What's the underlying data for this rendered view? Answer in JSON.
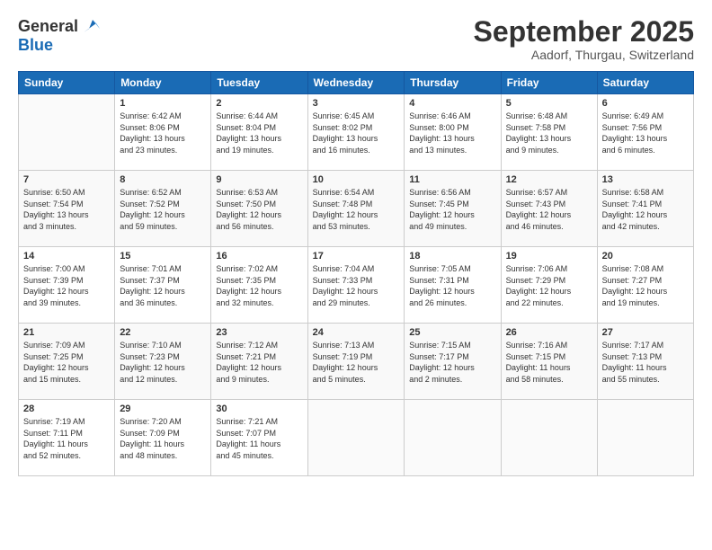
{
  "logo": {
    "general": "General",
    "blue": "Blue"
  },
  "title": "September 2025",
  "subtitle": "Aadorf, Thurgau, Switzerland",
  "weekdays": [
    "Sunday",
    "Monday",
    "Tuesday",
    "Wednesday",
    "Thursday",
    "Friday",
    "Saturday"
  ],
  "weeks": [
    [
      {
        "day": "",
        "info": ""
      },
      {
        "day": "1",
        "info": "Sunrise: 6:42 AM\nSunset: 8:06 PM\nDaylight: 13 hours\nand 23 minutes."
      },
      {
        "day": "2",
        "info": "Sunrise: 6:44 AM\nSunset: 8:04 PM\nDaylight: 13 hours\nand 19 minutes."
      },
      {
        "day": "3",
        "info": "Sunrise: 6:45 AM\nSunset: 8:02 PM\nDaylight: 13 hours\nand 16 minutes."
      },
      {
        "day": "4",
        "info": "Sunrise: 6:46 AM\nSunset: 8:00 PM\nDaylight: 13 hours\nand 13 minutes."
      },
      {
        "day": "5",
        "info": "Sunrise: 6:48 AM\nSunset: 7:58 PM\nDaylight: 13 hours\nand 9 minutes."
      },
      {
        "day": "6",
        "info": "Sunrise: 6:49 AM\nSunset: 7:56 PM\nDaylight: 13 hours\nand 6 minutes."
      }
    ],
    [
      {
        "day": "7",
        "info": "Sunrise: 6:50 AM\nSunset: 7:54 PM\nDaylight: 13 hours\nand 3 minutes."
      },
      {
        "day": "8",
        "info": "Sunrise: 6:52 AM\nSunset: 7:52 PM\nDaylight: 12 hours\nand 59 minutes."
      },
      {
        "day": "9",
        "info": "Sunrise: 6:53 AM\nSunset: 7:50 PM\nDaylight: 12 hours\nand 56 minutes."
      },
      {
        "day": "10",
        "info": "Sunrise: 6:54 AM\nSunset: 7:48 PM\nDaylight: 12 hours\nand 53 minutes."
      },
      {
        "day": "11",
        "info": "Sunrise: 6:56 AM\nSunset: 7:45 PM\nDaylight: 12 hours\nand 49 minutes."
      },
      {
        "day": "12",
        "info": "Sunrise: 6:57 AM\nSunset: 7:43 PM\nDaylight: 12 hours\nand 46 minutes."
      },
      {
        "day": "13",
        "info": "Sunrise: 6:58 AM\nSunset: 7:41 PM\nDaylight: 12 hours\nand 42 minutes."
      }
    ],
    [
      {
        "day": "14",
        "info": "Sunrise: 7:00 AM\nSunset: 7:39 PM\nDaylight: 12 hours\nand 39 minutes."
      },
      {
        "day": "15",
        "info": "Sunrise: 7:01 AM\nSunset: 7:37 PM\nDaylight: 12 hours\nand 36 minutes."
      },
      {
        "day": "16",
        "info": "Sunrise: 7:02 AM\nSunset: 7:35 PM\nDaylight: 12 hours\nand 32 minutes."
      },
      {
        "day": "17",
        "info": "Sunrise: 7:04 AM\nSunset: 7:33 PM\nDaylight: 12 hours\nand 29 minutes."
      },
      {
        "day": "18",
        "info": "Sunrise: 7:05 AM\nSunset: 7:31 PM\nDaylight: 12 hours\nand 26 minutes."
      },
      {
        "day": "19",
        "info": "Sunrise: 7:06 AM\nSunset: 7:29 PM\nDaylight: 12 hours\nand 22 minutes."
      },
      {
        "day": "20",
        "info": "Sunrise: 7:08 AM\nSunset: 7:27 PM\nDaylight: 12 hours\nand 19 minutes."
      }
    ],
    [
      {
        "day": "21",
        "info": "Sunrise: 7:09 AM\nSunset: 7:25 PM\nDaylight: 12 hours\nand 15 minutes."
      },
      {
        "day": "22",
        "info": "Sunrise: 7:10 AM\nSunset: 7:23 PM\nDaylight: 12 hours\nand 12 minutes."
      },
      {
        "day": "23",
        "info": "Sunrise: 7:12 AM\nSunset: 7:21 PM\nDaylight: 12 hours\nand 9 minutes."
      },
      {
        "day": "24",
        "info": "Sunrise: 7:13 AM\nSunset: 7:19 PM\nDaylight: 12 hours\nand 5 minutes."
      },
      {
        "day": "25",
        "info": "Sunrise: 7:15 AM\nSunset: 7:17 PM\nDaylight: 12 hours\nand 2 minutes."
      },
      {
        "day": "26",
        "info": "Sunrise: 7:16 AM\nSunset: 7:15 PM\nDaylight: 11 hours\nand 58 minutes."
      },
      {
        "day": "27",
        "info": "Sunrise: 7:17 AM\nSunset: 7:13 PM\nDaylight: 11 hours\nand 55 minutes."
      }
    ],
    [
      {
        "day": "28",
        "info": "Sunrise: 7:19 AM\nSunset: 7:11 PM\nDaylight: 11 hours\nand 52 minutes."
      },
      {
        "day": "29",
        "info": "Sunrise: 7:20 AM\nSunset: 7:09 PM\nDaylight: 11 hours\nand 48 minutes."
      },
      {
        "day": "30",
        "info": "Sunrise: 7:21 AM\nSunset: 7:07 PM\nDaylight: 11 hours\nand 45 minutes."
      },
      {
        "day": "",
        "info": ""
      },
      {
        "day": "",
        "info": ""
      },
      {
        "day": "",
        "info": ""
      },
      {
        "day": "",
        "info": ""
      }
    ]
  ]
}
